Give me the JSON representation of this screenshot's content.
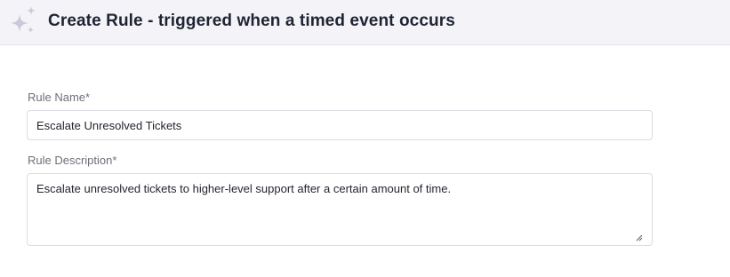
{
  "header": {
    "title": "Create Rule - triggered when a timed event occurs",
    "icon": "sparkle-icon"
  },
  "form": {
    "rule_name": {
      "label": "Rule Name*",
      "value": "Escalate Unresolved Tickets"
    },
    "rule_description": {
      "label": "Rule Description*",
      "value": "Escalate unresolved tickets to higher-level support after a certain amount of time."
    }
  },
  "colors": {
    "header_background": "#f3f3f8",
    "sparkle": "#c9c9d8",
    "label": "#6f6f7a",
    "text": "#222630",
    "border": "#dcdce3"
  }
}
